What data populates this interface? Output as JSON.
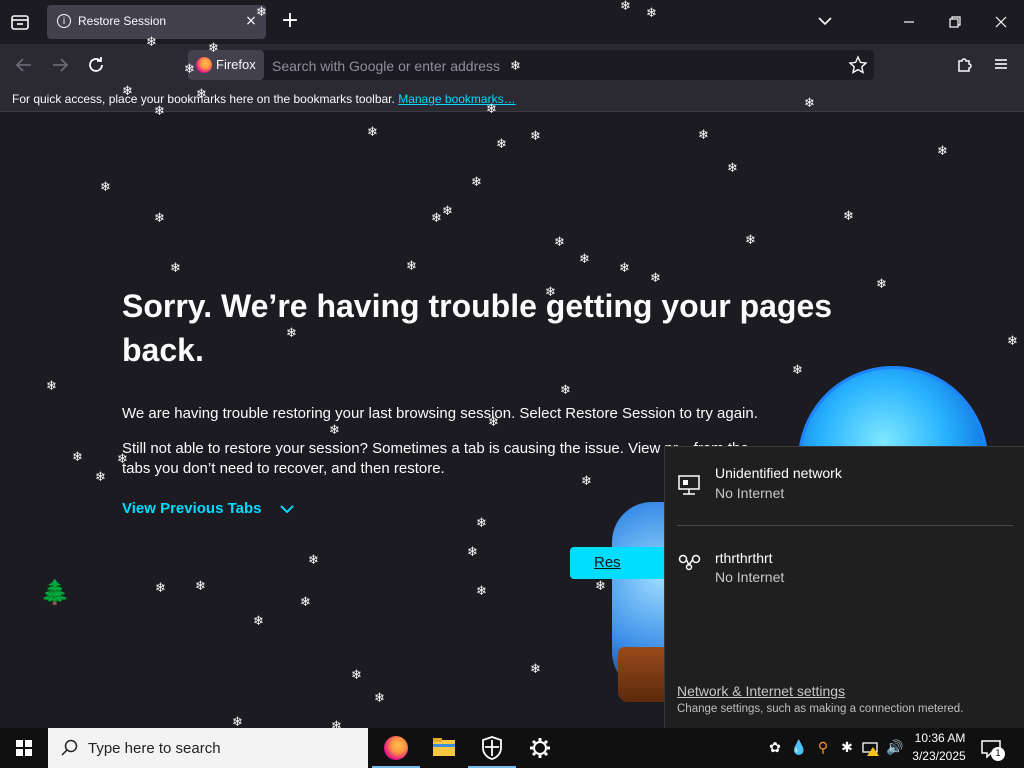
{
  "browser": {
    "tab": {
      "title": "Restore Session",
      "close_glyph": "×"
    },
    "newtab_glyph": "+",
    "identity_label": "Firefox",
    "url_placeholder": "Search with Google or enter address",
    "bookmarks_bar": {
      "prefix": "For quick access, place your bookmarks here on the bookmarks toolbar.",
      "link": "Manage bookmarks…"
    }
  },
  "page": {
    "title": "Sorry. We’re having trouble getting your pages back.",
    "paragraph1": "We are having trouble restoring your last browsing session. Select Restore Session to try again.",
    "paragraph2": "Still not able to restore your session? Sometimes a tab is causing the issue. View pr... from the tabs you don’t need to recover, and then restore.",
    "view_tabs": "View Previous Tabs",
    "restore_button": "Res"
  },
  "network_flyout": {
    "networks": [
      {
        "name": "Unidentified network",
        "status": "No Internet",
        "icon": "ethernet-icon"
      },
      {
        "name": "rthrthrthrt",
        "status": "No Internet",
        "icon": "dialup-icon"
      }
    ],
    "settings_link": "Network & Internet settings",
    "settings_sub": "Change settings, such as making a connection metered."
  },
  "taskbar": {
    "search_placeholder": "Type here to search",
    "time": "10:36 AM",
    "date": "3/23/2025",
    "notification_count": "1",
    "apps": [
      "firefox-icon",
      "file-explorer-icon",
      "security-shield-icon",
      "settings-gear-icon"
    ]
  },
  "decor": {
    "snowflake": "❄",
    "tree": "🌲"
  },
  "colors": {
    "accent": "#00ddff",
    "page_bg": "#1c1b22",
    "toolbar_bg": "#2b2a33",
    "taskbar_bg": "#101010",
    "flyout_bg": "#1f1f1f"
  }
}
